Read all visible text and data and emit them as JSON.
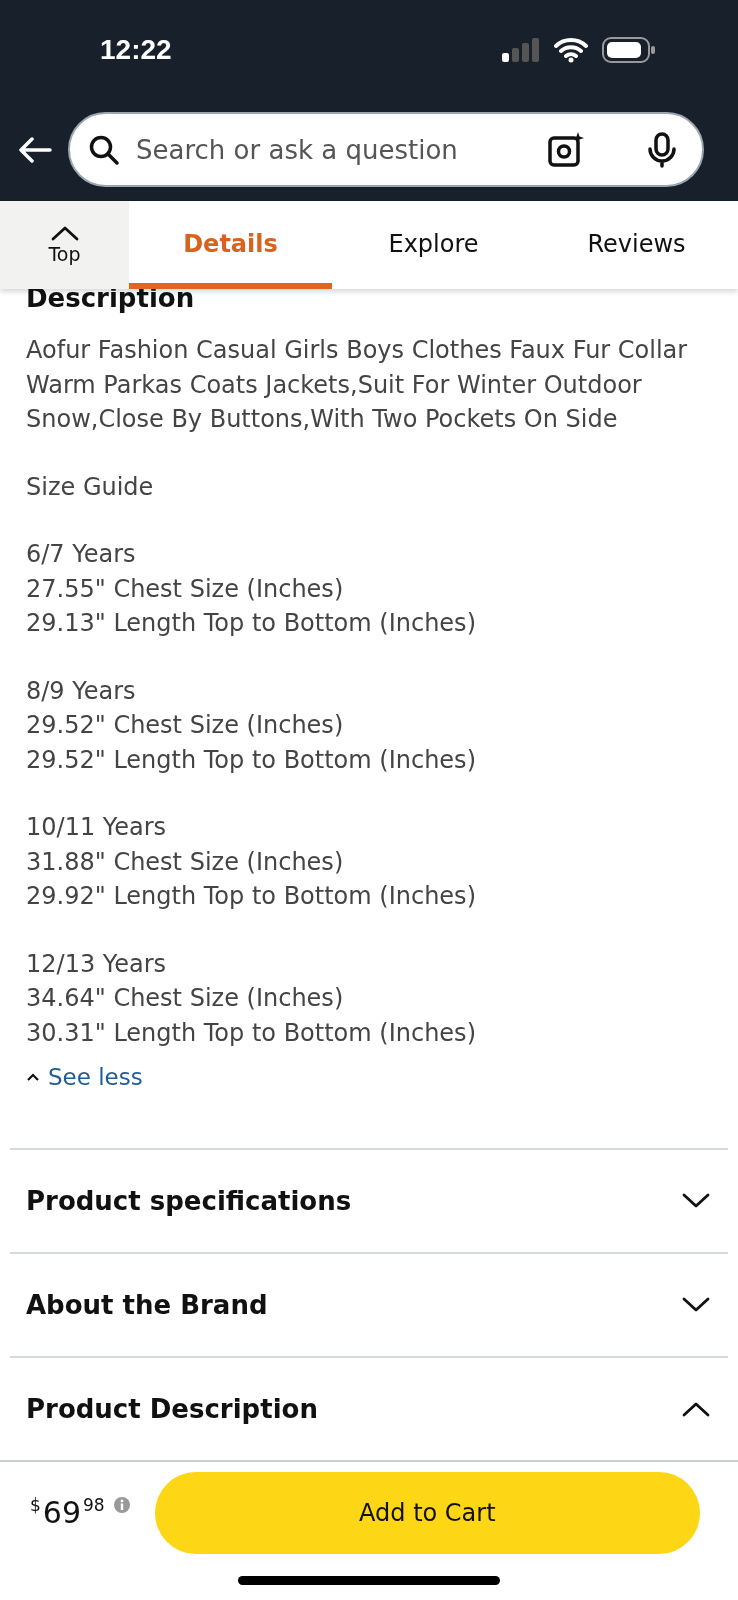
{
  "status_bar": {
    "time": "12:22"
  },
  "search": {
    "placeholder": "Search or ask a question"
  },
  "tabs": [
    {
      "label": "Top",
      "kind": "top",
      "selected": false
    },
    {
      "label": "Details",
      "kind": "tab",
      "selected": true
    },
    {
      "label": "Explore",
      "kind": "tab",
      "selected": false
    },
    {
      "label": "Reviews",
      "kind": "tab",
      "selected": false
    }
  ],
  "description": {
    "heading": "Description",
    "text": "Aofur Fashion Casual Girls Boys Clothes Faux Fur Collar Warm Parkas Coats Jackets,Suit For Winter Outdoor Snow,Close By Buttons,With Two Pockets On Side",
    "size_guide": "Size Guide",
    "sizes": [
      {
        "lines": [
          "6/7 Years",
          "27.55\" Chest Size (Inches)",
          "29.13\" Length Top to Bottom (Inches)"
        ]
      },
      {
        "lines": [
          "8/9 Years",
          "29.52\" Chest Size (Inches)",
          "29.52\" Length Top to Bottom (Inches)"
        ]
      },
      {
        "lines": [
          "10/11 Years",
          "31.88\" Chest Size (Inches)",
          "29.92\" Length Top to Bottom (Inches)"
        ]
      },
      {
        "lines": [
          "12/13 Years",
          "34.64\" Chest Size (Inches)",
          "30.31\" Length Top to Bottom (Inches)"
        ]
      }
    ],
    "toggle": "See less",
    "expanded": true
  },
  "sections": [
    {
      "title": "Product specifications",
      "expanded": false
    },
    {
      "title": "About the Brand",
      "expanded": false
    },
    {
      "title": "Product Description",
      "expanded": true
    }
  ],
  "buy_bar": {
    "currency": "$",
    "whole": "69",
    "fraction": "98",
    "button": "Add to Cart"
  }
}
